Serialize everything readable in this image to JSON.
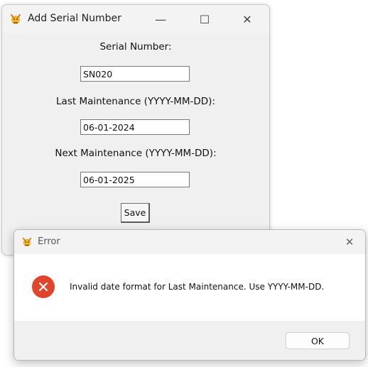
{
  "main_window": {
    "title": "Add Serial Number",
    "controls": {
      "minimize": "—",
      "maximize": "☐",
      "close": "✕"
    },
    "form": {
      "serial_label": "Serial Number:",
      "serial_value": "SN020",
      "last_label": "Last Maintenance (YYYY-MM-DD):",
      "last_value": "06-01-2024",
      "next_label": "Next Maintenance (YYYY-MM-DD):",
      "next_value": "06-01-2025",
      "save_label": "Save"
    },
    "icons": {
      "app": "app-icon",
      "minimize": "minimize-icon",
      "maximize": "maximize-icon",
      "close": "close-icon"
    }
  },
  "error_dialog": {
    "title": "Error",
    "close": "✕",
    "message": "Invalid date format for Last Maintenance. Use YYYY-MM-DD.",
    "ok_label": "OK",
    "icons": {
      "app": "app-icon",
      "error": "error-icon",
      "close": "close-icon"
    },
    "colors": {
      "error_icon": "#e0442b"
    }
  }
}
